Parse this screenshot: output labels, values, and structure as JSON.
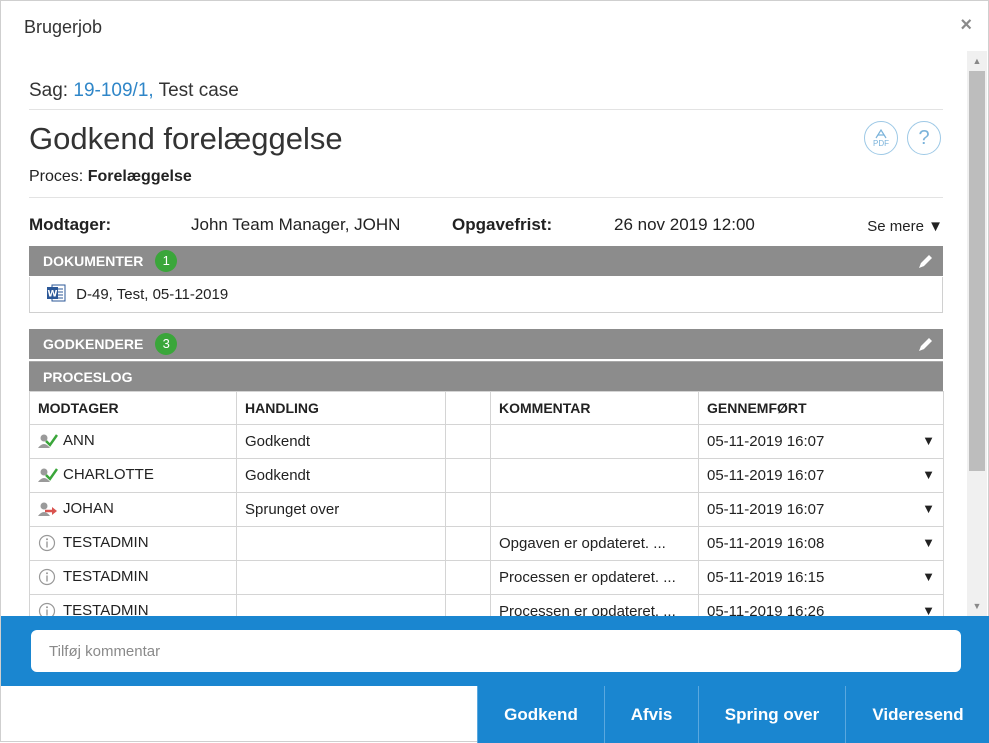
{
  "dialog": {
    "title": "Brugerjob",
    "close": "×"
  },
  "case": {
    "label": "Sag:",
    "number": "19-109/1,",
    "name": "Test case"
  },
  "task": {
    "title": "Godkend forelæggelse",
    "process_label": "Proces:",
    "process_value": "Forelæggelse",
    "pdf_label": "PDF",
    "help_label": "?"
  },
  "info": {
    "recipient_label": "Modtager:",
    "recipient_value": "John Team Manager, JOHN",
    "deadline_label": "Opgavefrist:",
    "deadline_value": "26 nov 2019 12:00",
    "see_more": "Se mere ▼"
  },
  "documents": {
    "header": "DOKUMENTER",
    "count": "1",
    "items": [
      {
        "icon": "word-icon",
        "label": "D-49, Test, 05-11-2019"
      }
    ]
  },
  "approvers": {
    "header": "GODKENDERE",
    "count": "3"
  },
  "process_log": {
    "header": "PROCESLOG",
    "columns": [
      "MODTAGER",
      "HANDLING",
      "",
      "KOMMENTAR",
      "GENNEMFØRT"
    ],
    "rows": [
      {
        "icon": "approved-user-icon",
        "recipient": "ANN",
        "action": "Godkendt",
        "comment": "",
        "done": "05-11-2019 16:07"
      },
      {
        "icon": "approved-user-icon",
        "recipient": "CHARLOTTE",
        "action": "Godkendt",
        "comment": "",
        "done": "05-11-2019 16:07"
      },
      {
        "icon": "skipped-user-icon",
        "recipient": "JOHAN",
        "action": "Sprunget over",
        "comment": "",
        "done": "05-11-2019 16:07"
      },
      {
        "icon": "info-icon",
        "recipient": "TESTADMIN",
        "action": "",
        "comment": "Opgaven er opdateret. ...",
        "done": "05-11-2019 16:08"
      },
      {
        "icon": "info-icon",
        "recipient": "TESTADMIN",
        "action": "",
        "comment": "Processen er opdateret. ...",
        "done": "05-11-2019 16:15"
      },
      {
        "icon": "info-icon",
        "recipient": "TESTADMIN",
        "action": "",
        "comment": "Processen er opdateret. ...",
        "done": "05-11-2019 16:26"
      }
    ]
  },
  "comment": {
    "placeholder": "Tilføj kommentar"
  },
  "actions": {
    "approve": "Godkend",
    "reject": "Afvis",
    "skip": "Spring over",
    "forward": "Videresend"
  },
  "colors": {
    "accent": "#1a86d0",
    "section": "#8c8c8c",
    "badge": "#3aa63a",
    "link": "#2f86c8"
  }
}
